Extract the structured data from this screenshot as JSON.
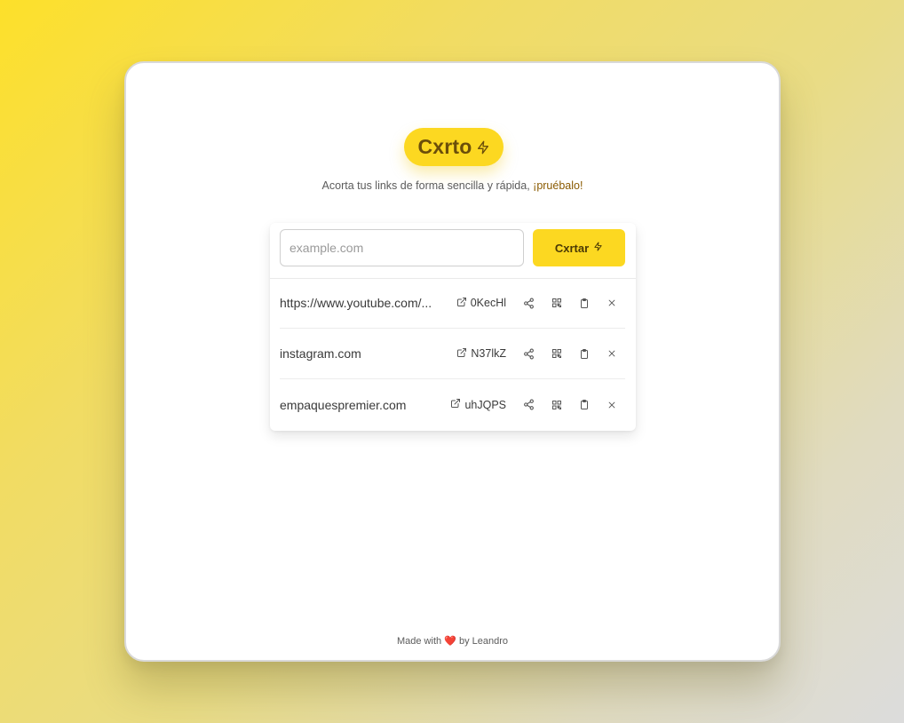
{
  "app": {
    "logo_text": "Cxrto",
    "tagline_main": "Acorta tus links de forma sencilla y rápida, ",
    "tagline_accent": "¡pruébalo!"
  },
  "form": {
    "input_value": "",
    "input_placeholder": "example.com",
    "submit_label": "Cxrtar"
  },
  "links": [
    {
      "original": "https://www.youtube.com/...",
      "short": "0KecHl"
    },
    {
      "original": "instagram.com",
      "short": "N37lkZ"
    },
    {
      "original": "empaquespremier.com",
      "short": "uhJQPS"
    }
  ],
  "icons": {
    "logo": "lightning-bolt-icon",
    "submit": "lightning-bolt-icon",
    "external": "external-link-icon",
    "share": "share-icon",
    "qr": "qr-code-icon",
    "copy": "clipboard-icon",
    "delete": "close-icon"
  },
  "footer": {
    "prefix": "Made with",
    "heart": "❤️",
    "suffix": "by Leandro"
  },
  "colors": {
    "brand_yellow": "#fcd821",
    "accent_brown": "#8a5a00",
    "logo_text": "#6b4e0a"
  }
}
